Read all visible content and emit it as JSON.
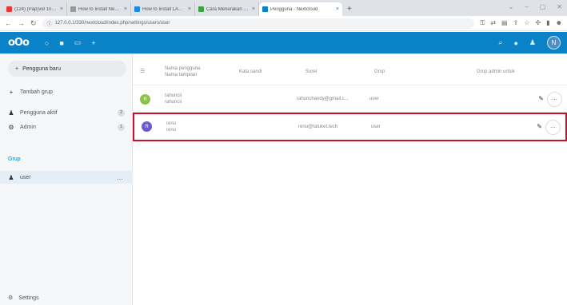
{
  "browser": {
    "tabs": [
      {
        "title": "(124) (Pap)vid 10 [12] ..."
      },
      {
        "title": "How to Install NextCloud in ..."
      },
      {
        "title": "How to Install LAMP Stack ..."
      },
      {
        "title": "Cara Menerakan Versi MySQL ..."
      },
      {
        "title": "Pengguna - Nextcloud",
        "active": true
      }
    ],
    "new_tab": "+",
    "url": "127.0.0.1/330/nextcloud/index.php/settings/users/user"
  },
  "header": {
    "logo": "oOo",
    "user_initial": "N",
    "accent": "#0a82c8"
  },
  "sidebar": {
    "new_user": "Pengguna baru",
    "items": [
      {
        "label": "Tambah grup",
        "icon": "plus-icon"
      },
      {
        "label": "Pengguna aktif",
        "count": "2",
        "icon": "users-icon"
      },
      {
        "label": "Admin",
        "count": "1",
        "icon": "shield-icon"
      }
    ],
    "group_caption": "Grup",
    "groups": [
      {
        "label": "user",
        "more": "…",
        "icon": "users-icon"
      }
    ],
    "settings": "Settings"
  },
  "table": {
    "headers": {
      "name_line1": "Nama pengguna",
      "name_line2": "Nama tampilan",
      "password": "Kata sandi",
      "email": "Surel",
      "groups": "Grup",
      "group_admin": "Grup admin untuk"
    },
    "rows": [
      {
        "initial": "R",
        "avatar_color": "#8bc34a",
        "username": "rahuncii",
        "display_name": "rahuncii",
        "email": "rahunchandy@gmail.c...",
        "group": "user"
      },
      {
        "initial": "R",
        "avatar_color": "#6a5acd",
        "username": "renu",
        "display_name": "renu",
        "email": "renu@tatuket.tech",
        "group": "user",
        "highlighted": true,
        "highlight_color": "#c8102e"
      }
    ]
  }
}
